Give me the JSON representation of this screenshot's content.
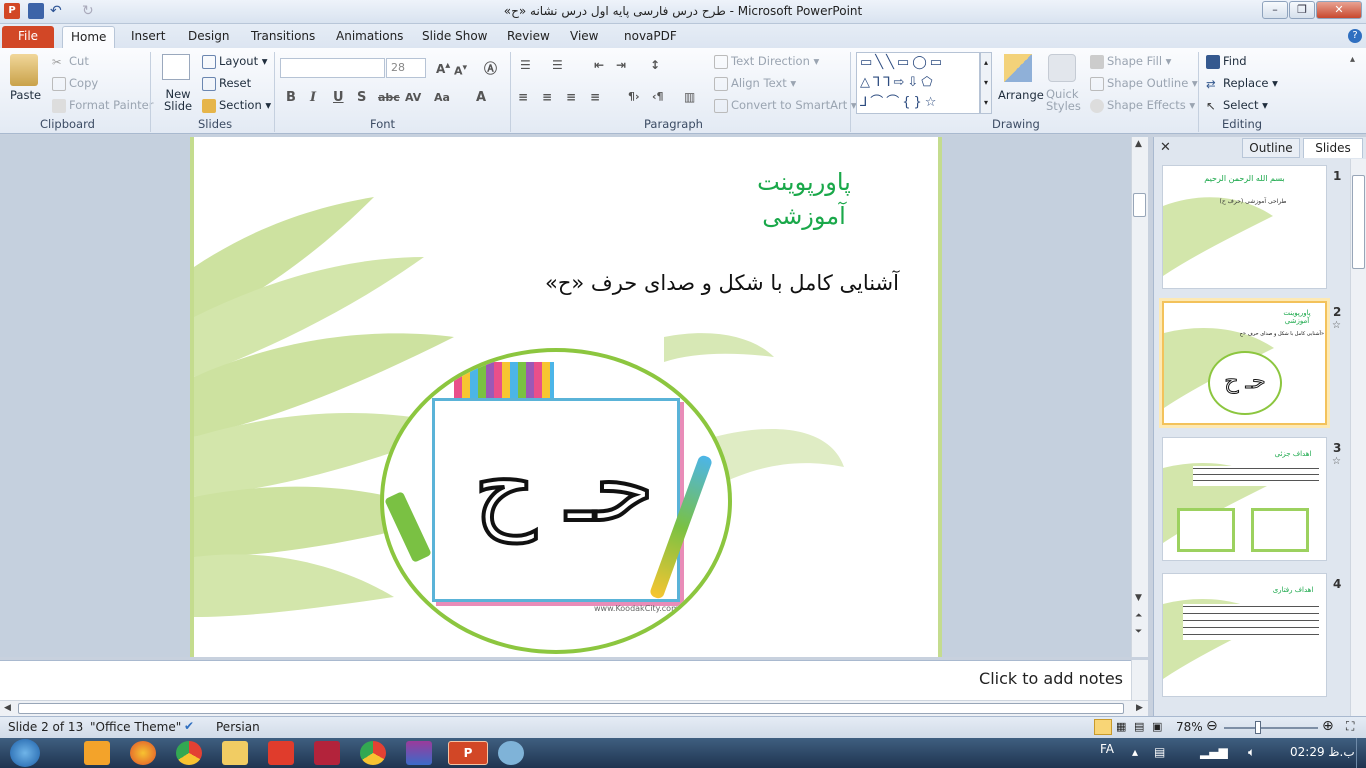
{
  "window": {
    "title": "«طرح درس فارسی پایه اول درس نشانه «ح  -  Microsoft PowerPoint",
    "min_label": "–",
    "max_label": "❐",
    "close_label": "✕"
  },
  "tabs": [
    "File",
    "Home",
    "Insert",
    "Design",
    "Transitions",
    "Animations",
    "Slide Show",
    "Review",
    "View",
    "novaPDF"
  ],
  "ribbon": {
    "clipboard": {
      "paste": "Paste",
      "cut": "Cut",
      "copy": "Copy",
      "format_painter": "Format Painter",
      "label": "Clipboard"
    },
    "slides": {
      "new_slide_line1": "New",
      "new_slide_line2": "Slide",
      "layout": "Layout",
      "reset": "Reset",
      "section": "Section",
      "label": "Slides"
    },
    "font": {
      "font_name": "",
      "font_size": "28",
      "label": "Font"
    },
    "paragraph": {
      "text_direction": "Text Direction",
      "align_text": "Align Text",
      "convert_smartart": "Convert to SmartArt",
      "label": "Paragraph"
    },
    "drawing": {
      "arrange": "Arrange",
      "quick_styles_1": "Quick",
      "quick_styles_2": "Styles",
      "shape_fill": "Shape Fill",
      "shape_outline": "Shape Outline",
      "shape_effects": "Shape Effects",
      "label": "Drawing"
    },
    "editing": {
      "find": "Find",
      "replace": "Replace",
      "select": "Select",
      "label": "Editing"
    }
  },
  "slide": {
    "title_line1": "پاورپوینت",
    "title_line2": "آموزشی",
    "body": "آشنایی کامل با شکل و صدای حرف «ح»",
    "image_letters": "حـ ح",
    "watermark": "www.KoodakCity.com"
  },
  "notes": {
    "placeholder": "Click to add notes"
  },
  "side_panel": {
    "tab_outline": "Outline",
    "tab_slides": "Slides",
    "thumbs": [
      {
        "num": "1",
        "title": "بسم الله الرحمن الرحیم",
        "sub": "طراحی آموزشی (حرف ح)"
      },
      {
        "num": "2",
        "title": "پاورپوینت آموزشی",
        "sub": "آشنایی کامل با شکل و صدای حرف «ح»"
      },
      {
        "num": "3",
        "title": "اهداف جزئی",
        "sub": ""
      },
      {
        "num": "4",
        "title": "اهداف رفتاری",
        "sub": ""
      }
    ]
  },
  "status": {
    "slide_info": "Slide 2 of 13",
    "theme": "\"Office Theme\"",
    "language": "Persian",
    "zoom": "78%"
  },
  "taskbar": {
    "lang": "FA",
    "time": "02:29 ب.ظ"
  },
  "colors": {
    "accent_green": "#1aa84a",
    "file_tab": "#d24726",
    "slide_leaf": "#c4dc8e"
  }
}
